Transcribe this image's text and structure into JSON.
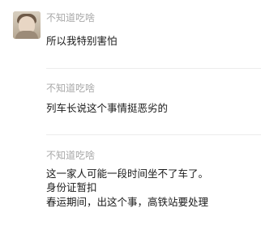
{
  "comments": [
    {
      "username": "不知道吃啥",
      "lines": [
        "所以我特别害怕"
      ],
      "has_avatar": true
    },
    {
      "username": "不知道吃啥",
      "lines": [
        "列车长说这个事情挺恶劣的"
      ],
      "has_avatar": false
    },
    {
      "username": "不知道吃啥",
      "lines": [
        "这一家人可能一段时间坐不了车了。",
        "身份证暂扣",
        "春运期间，出这个事，高铁站要处理"
      ],
      "has_avatar": false
    }
  ],
  "colors": {
    "username": "#a9a9a9",
    "content": "#1a1a1a",
    "divider": "#ececec",
    "background": "#ffffff"
  }
}
